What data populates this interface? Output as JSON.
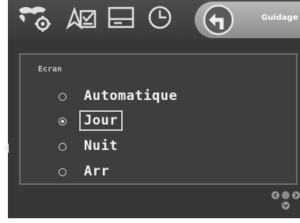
{
  "topbar": {
    "icons": [
      "world-settings-icon",
      "navigation-settings-icon",
      "display-icon",
      "clock-icon"
    ],
    "guidage_tab": {
      "icon": "turn-left-icon",
      "label": "Guidage"
    }
  },
  "panel": {
    "title": "Ecran",
    "options": [
      {
        "label": "Automatique",
        "checked": false
      },
      {
        "label": "Jour",
        "checked": true,
        "selected": true
      },
      {
        "label": "Nuit",
        "checked": false
      },
      {
        "label": "Arr",
        "checked": false
      }
    ]
  },
  "nav": {
    "left_arrow": "chevron-left-icon",
    "dpad": "directional-pad-icon"
  },
  "colors": {
    "background": "#373737",
    "text": "#f2f2f2",
    "accent": "#cfcfcf"
  }
}
